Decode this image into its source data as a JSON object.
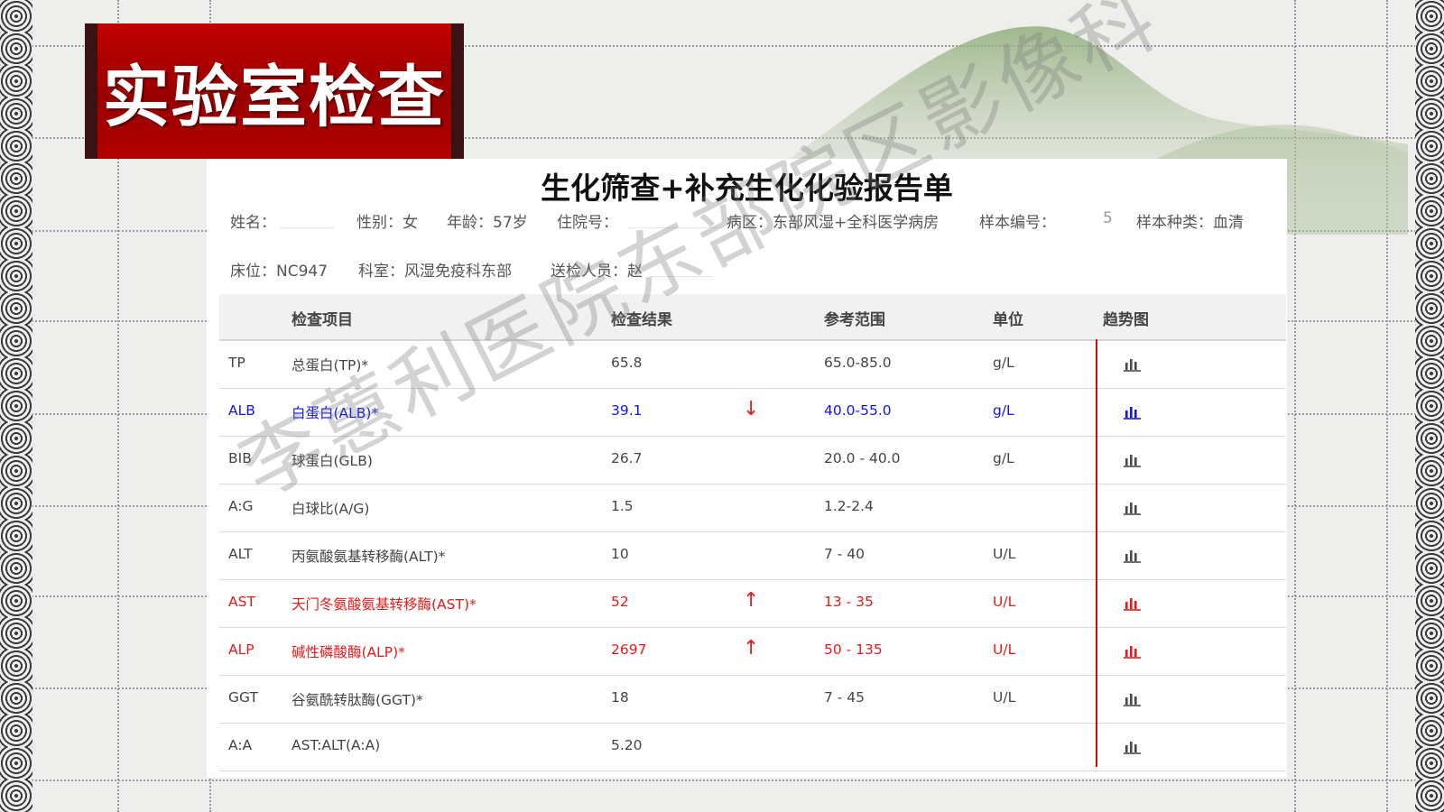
{
  "header_badge": "实验室检查",
  "report": {
    "title": "生化筛查+补充生化化验报告单",
    "info_line1": {
      "name": "姓名：",
      "gender": "性别：女",
      "age": "年龄：57岁",
      "inpatient_no": "住院号：",
      "ward": "病区：东部风湿+全科医学病房",
      "sample_no": "样本编号：",
      "sample_no_tail": "5",
      "sample_type": "样本种类：血清"
    },
    "info_line2": {
      "bed": "床位：NC947",
      "department": "科室：风湿免疫科东部",
      "sender": "送检人员：赵"
    }
  },
  "table": {
    "headers": [
      "检查项目",
      "检查结果",
      "参考范围",
      "单位",
      "趋势图"
    ],
    "rows": [
      {
        "code": "TP",
        "name": "总蛋白(TP)*",
        "result": "65.8",
        "flag": "",
        "range": "65.0-85.0",
        "unit": "g/L",
        "status": "normal"
      },
      {
        "code": "ALB",
        "name": "白蛋白(ALB)*",
        "result": "39.1",
        "flag": "↓",
        "range": "40.0-55.0",
        "unit": "g/L",
        "status": "low"
      },
      {
        "code": "BIB",
        "name": "球蛋白(GLB)",
        "result": "26.7",
        "flag": "",
        "range": "20.0 - 40.0",
        "unit": "g/L",
        "status": "normal"
      },
      {
        "code": "A:G",
        "name": "白球比(A/G)",
        "result": "1.5",
        "flag": "",
        "range": "1.2-2.4",
        "unit": "",
        "status": "normal"
      },
      {
        "code": "ALT",
        "name": "丙氨酸氨基转移酶(ALT)*",
        "result": "10",
        "flag": "",
        "range": "7 - 40",
        "unit": "U/L",
        "status": "normal"
      },
      {
        "code": "AST",
        "name": "天门冬氨酸氨基转移酶(AST)*",
        "result": "52",
        "flag": "↑",
        "range": "13 - 35",
        "unit": "U/L",
        "status": "high"
      },
      {
        "code": "ALP",
        "name": "碱性磷酸酶(ALP)*",
        "result": "2697",
        "flag": "↑",
        "range": "50 - 135",
        "unit": "U/L",
        "status": "high"
      },
      {
        "code": "GGT",
        "name": "谷氨酰转肽酶(GGT)*",
        "result": "18",
        "flag": "",
        "range": "7 - 45",
        "unit": "U/L",
        "status": "normal"
      },
      {
        "code": "A:A",
        "name": "AST:ALT(A:A)",
        "result": "5.20",
        "flag": "",
        "range": "",
        "unit": "",
        "status": "normal"
      }
    ]
  },
  "watermark": "李蕙利医院东部院区影像科",
  "colors": {
    "badge_red": "#c00000",
    "low_blue": "#1414e8",
    "high_red": "#e81a1a",
    "divider_red": "#cc1010"
  },
  "icons": {
    "trend": "bar-chart-icon"
  }
}
